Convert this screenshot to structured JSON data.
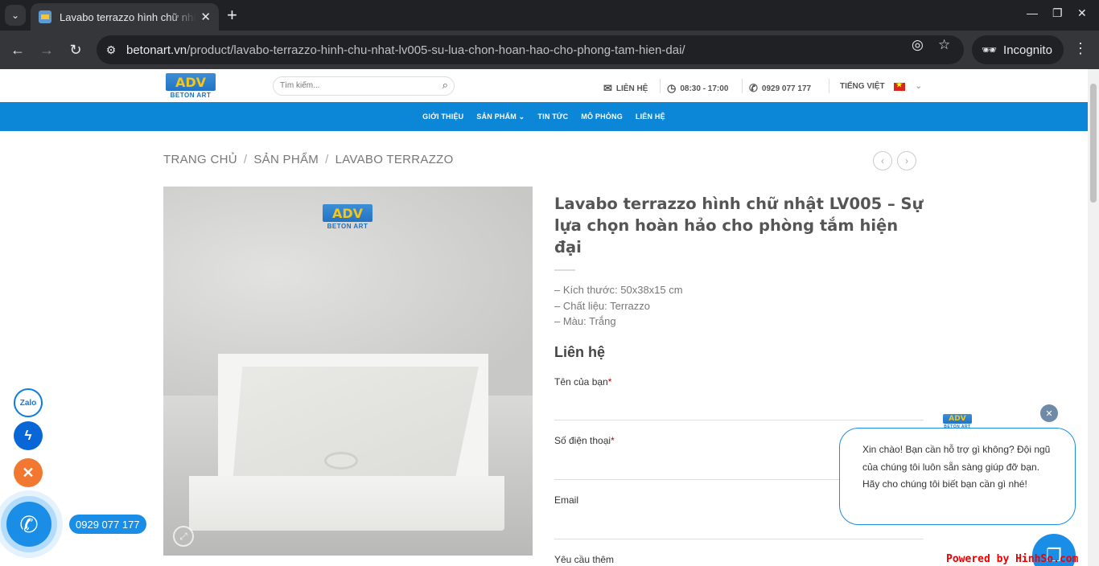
{
  "browser": {
    "tab_title": "Lavabo terrazzo hình chữ nhật",
    "url_domain": "betonart.vn",
    "url_path": "/product/lavabo-terrazzo-hinh-chu-nhat-lv005-su-lua-chon-hoan-hao-cho-phong-tam-hien-dai/",
    "incognito_label": "Incognito"
  },
  "header": {
    "logo_mark": "ADV",
    "logo_text": "BETON ART",
    "search_placeholder": "Tìm kiếm...",
    "contact": "LIÊN HỆ",
    "hours": "08:30 - 17:00",
    "phone": "0929 077 177",
    "language": "TIẾNG VIỆT"
  },
  "nav": {
    "items": [
      "GIỚI THIỆU",
      "SẢN PHẨM",
      "TIN TỨC",
      "MÔ PHỎNG",
      "LIÊN HỆ"
    ]
  },
  "breadcrumb": [
    "TRANG CHỦ",
    "SẢN PHẨM",
    "LAVABO TERRAZZO"
  ],
  "product": {
    "title": "Lavabo terrazzo hình chữ nhật LV005 – Sự lựa chọn hoàn hảo cho phòng tắm hiện đại",
    "specs": [
      "– Kích thước: 50x38x15 cm",
      "– Chất liệu: Terrazzo",
      "– Màu: Trắng"
    ]
  },
  "form": {
    "heading": "Liên hệ",
    "name_label": "Tên của bạn",
    "phone_label": "Số điện thoại",
    "email_label": "Email",
    "extra_label": "Yêu cầu thêm",
    "required_mark": "*"
  },
  "widgets": {
    "zalo": "Zalo",
    "phone_number": "0929 077 177",
    "chat_message": "Xin chào! Bạn cần hỗ trợ gì không? Đội ngũ của chúng tôi luôn sẵn sàng giúp đỡ bạn. Hãy cho chúng tôi biết bạn cần gì nhé!",
    "powered": "Powered by HinhSo.com"
  },
  "colors": {
    "nav_blue": "#0c86d6",
    "widget_blue": "#1a8ee6",
    "close_orange": "#f27731"
  }
}
